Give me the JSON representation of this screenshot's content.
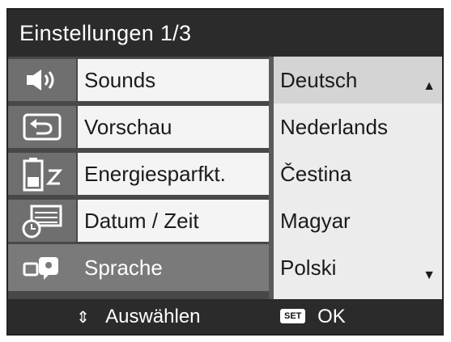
{
  "screen": {
    "title": "Einstellungen 1/3"
  },
  "menu": {
    "items": [
      {
        "label": "Sounds",
        "icon": "speaker-icon"
      },
      {
        "label": "Vorschau",
        "icon": "return-arrow-icon"
      },
      {
        "label": "Energiesparfkt.",
        "icon": "battery-sleep-icon"
      },
      {
        "label": "Datum / Zeit",
        "icon": "calendar-clock-icon"
      },
      {
        "label": "Sprache",
        "icon": "language-icon"
      }
    ],
    "selected": "Sprache"
  },
  "languages": {
    "options": [
      "Deutsch",
      "Nederlands",
      "Čestina",
      "Magyar",
      "Polski"
    ],
    "current": "Deutsch"
  },
  "footer": {
    "nav_label": "Auswählen",
    "set_badge": "SET",
    "ok_label": "OK"
  },
  "colors": {
    "title_background": "#2b2b2b",
    "menu_label_background": "#f4f4f4",
    "selected_row": "#7a7a7a",
    "language_list_background": "#ececec"
  }
}
